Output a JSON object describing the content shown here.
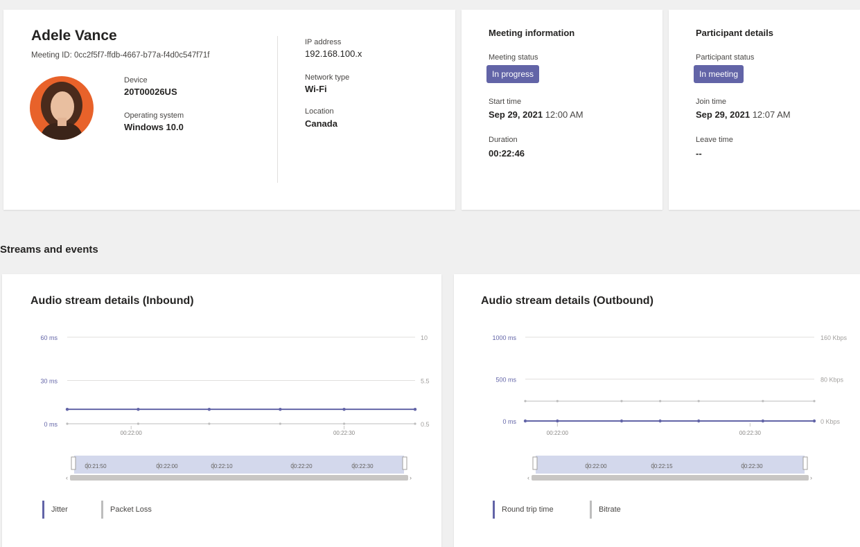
{
  "participant": {
    "name": "Adele Vance",
    "meeting_id": "Meeting ID: 0cc2f5f7-ffdb-4667-b77a-f4d0c547f71f",
    "device_label": "Device",
    "device_value": "20T00026US",
    "os_label": "Operating system",
    "os_value": "Windows 10.0",
    "ip_label": "IP address",
    "ip_value": "192.168.100.x",
    "network_label": "Network type",
    "network_value": "Wi-Fi",
    "location_label": "Location",
    "location_value": "Canada"
  },
  "meeting_info": {
    "title": "Meeting information",
    "status_label": "Meeting status",
    "status_value": "In progress",
    "start_label": "Start time",
    "start_date": "Sep 29, 2021",
    "start_time": "12:00 AM",
    "duration_label": "Duration",
    "duration_value": "00:22:46"
  },
  "participant_details": {
    "title": "Participant details",
    "status_label": "Participant status",
    "status_value": "In meeting",
    "join_label": "Join time",
    "join_date": "Sep 29, 2021",
    "join_time": "12:07 AM",
    "leave_label": "Leave time",
    "leave_value": "--"
  },
  "streams": {
    "section_title": "Streams and events"
  },
  "colors": {
    "accent": "#6264a7",
    "secondary_series": "#bdbdbd",
    "badge_text": "#ffffff"
  },
  "chart_data": [
    {
      "type": "line",
      "title": "Audio stream details (Inbound)",
      "left_axis": {
        "ticks": [
          "0 ms",
          "30 ms",
          "60 ms"
        ],
        "range": [
          0,
          60
        ]
      },
      "right_axis": {
        "ticks": [
          "0.5",
          "5.5",
          "10"
        ],
        "range": [
          0.5,
          10
        ]
      },
      "x_ticks": [
        "00:22:00",
        "00:22:30"
      ],
      "series": [
        {
          "name": "Jitter",
          "axis": "left",
          "color": "#6264a7",
          "x": [
            "00:21:51",
            "00:22:01",
            "00:22:11",
            "00:22:21",
            "00:22:30",
            "00:22:40"
          ],
          "values": [
            10,
            10,
            10,
            10,
            10,
            10
          ]
        },
        {
          "name": "Packet Loss",
          "axis": "right",
          "color": "#bdbdbd",
          "x": [
            "00:21:51",
            "00:22:01",
            "00:22:11",
            "00:22:21",
            "00:22:30",
            "00:22:40"
          ],
          "values": [
            0.5,
            0.5,
            0.5,
            0.5,
            0.5,
            0.5
          ]
        }
      ],
      "navigator_ticks": [
        "00:21:50",
        "00:22:00",
        "00:22:10",
        "00:22:20",
        "00:22:30"
      ],
      "legend_position": "bottom-left"
    },
    {
      "type": "line",
      "title": "Audio stream details (Outbound)",
      "left_axis": {
        "ticks": [
          "0 ms",
          "500 ms",
          "1000 ms"
        ],
        "range": [
          0,
          1000
        ]
      },
      "right_axis": {
        "ticks": [
          "0 Kbps",
          "80 Kbps",
          "160 Kbps"
        ],
        "range": [
          0,
          160
        ]
      },
      "x_ticks": [
        "00:22:00",
        "00:22:30"
      ],
      "series": [
        {
          "name": "Round trip time",
          "axis": "left",
          "color": "#6264a7",
          "x": [
            "00:21:55",
            "00:22:00",
            "00:22:10",
            "00:22:16",
            "00:22:22",
            "00:22:32",
            "00:22:40"
          ],
          "values": [
            0,
            0,
            0,
            0,
            0,
            0,
            0
          ]
        },
        {
          "name": "Bitrate",
          "axis": "right",
          "color": "#bdbdbd",
          "x": [
            "00:21:55",
            "00:22:00",
            "00:22:10",
            "00:22:16",
            "00:22:22",
            "00:22:32",
            "00:22:40"
          ],
          "values": [
            38,
            38,
            38,
            38,
            38,
            38,
            38
          ]
        }
      ],
      "navigator_ticks": [
        "00:22:00",
        "00:22:15",
        "00:22:30"
      ],
      "legend_position": "bottom-left"
    }
  ]
}
